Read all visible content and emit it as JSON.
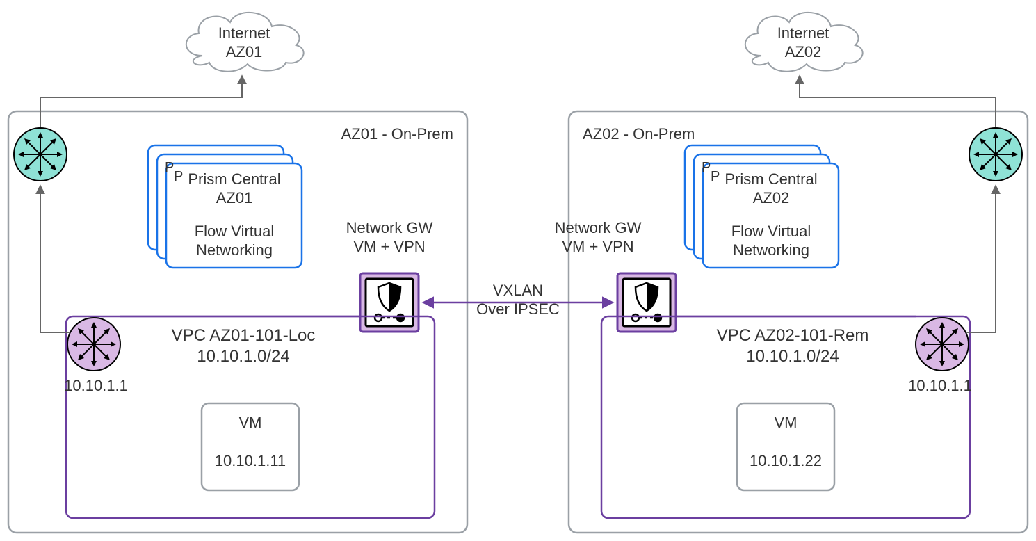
{
  "cloud": {
    "left": {
      "line1": "Internet",
      "line2": "AZ01"
    },
    "right": {
      "line1": "Internet",
      "line2": "AZ02"
    }
  },
  "az": {
    "left": {
      "title": "AZ01 - On-Prem"
    },
    "right": {
      "title": "AZ02 - On-Prem"
    }
  },
  "prism": {
    "left": {
      "line1": "Prism Central",
      "line2": "AZ01",
      "line3": "Flow Virtual",
      "line4": "Networking"
    },
    "right": {
      "line1": "Prism Central",
      "line2": "AZ02",
      "line3": "Flow Virtual",
      "line4": "Networking"
    }
  },
  "gw_label": {
    "left": {
      "line1": "Network GW",
      "line2": "VM + VPN"
    },
    "right": {
      "line1": "Network GW",
      "line2": "VM + VPN"
    }
  },
  "vpc": {
    "left": {
      "line1": "VPC AZ01-101-Loc",
      "line2": "10.10.1.0/24",
      "router_ip": "10.10.1.1"
    },
    "right": {
      "line1": "VPC AZ02-101-Rem",
      "line2": "10.10.1.0/24",
      "router_ip": "10.10.1.1"
    }
  },
  "vm": {
    "left": {
      "name": "VM",
      "ip": "10.10.1.11"
    },
    "right": {
      "name": "VM",
      "ip": "10.10.1.22"
    }
  },
  "link": {
    "line1": "VXLAN",
    "line2": "Over IPSEC"
  },
  "colors": {
    "gray": "#9aa0a6",
    "blue": "#1a73e8",
    "purple": "#6b3fa0",
    "purpleFill": "#d9b8e4",
    "teal": "#8fe2d6",
    "black": "#333333"
  }
}
